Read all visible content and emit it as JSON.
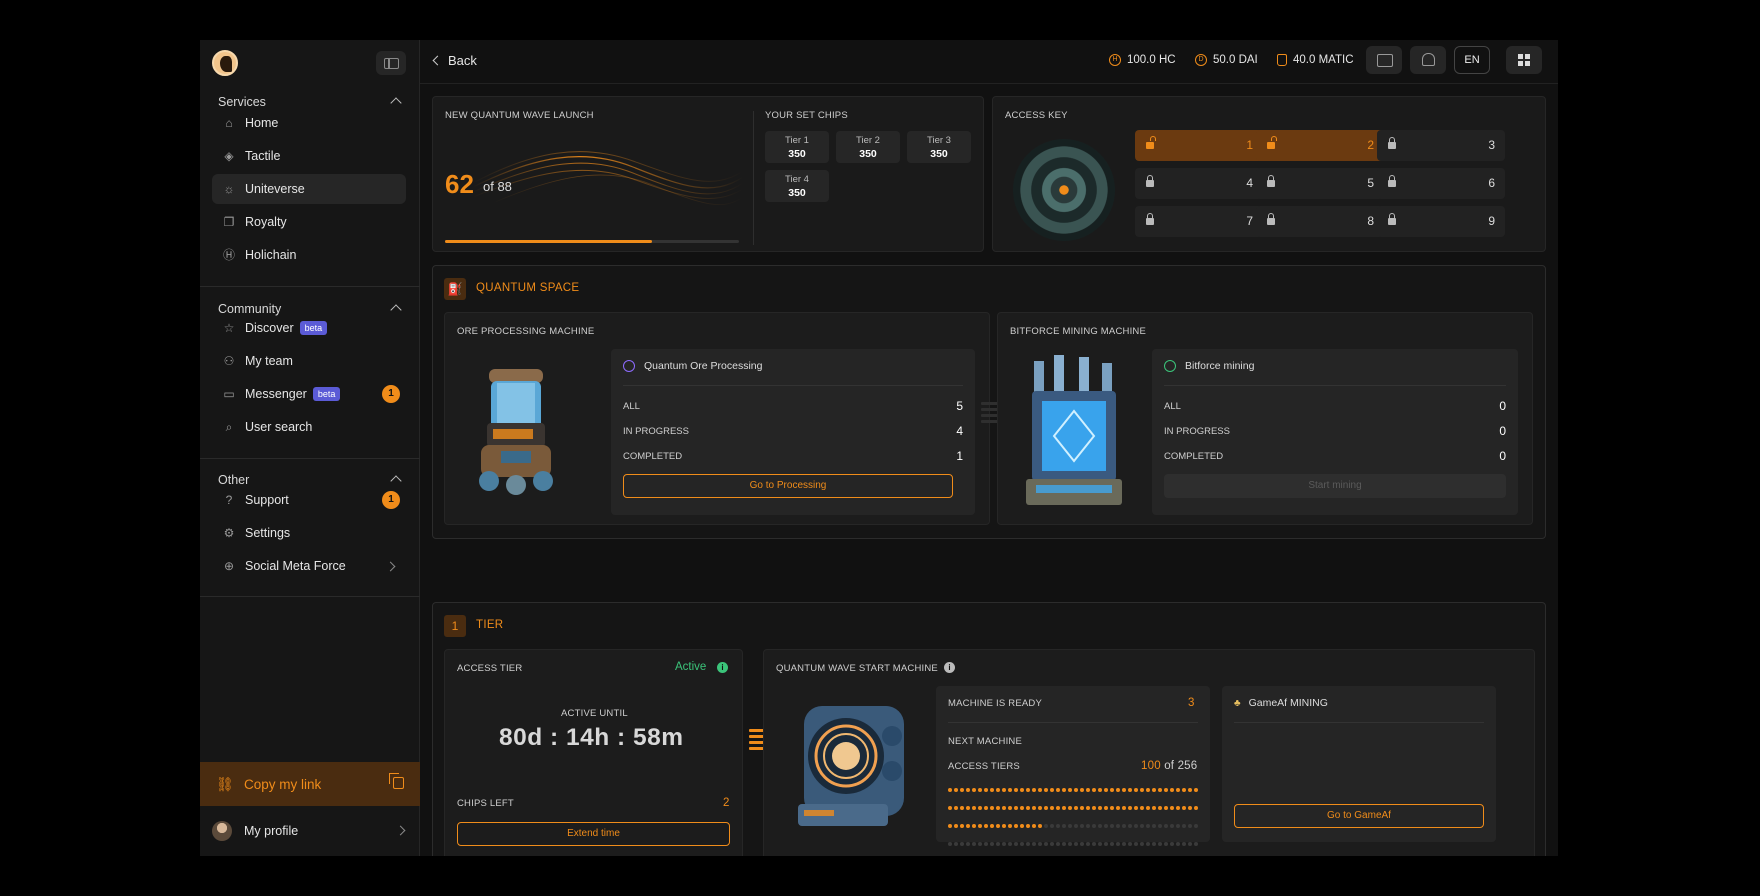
{
  "sidebar": {
    "services": {
      "title": "Services",
      "items": [
        {
          "label": "Home",
          "icon": "home-icon"
        },
        {
          "label": "Tactile",
          "icon": "layers-icon"
        },
        {
          "label": "Uniteverse",
          "icon": "sun-icon"
        },
        {
          "label": "Royalty",
          "icon": "copy-icon"
        },
        {
          "label": "Holichain",
          "icon": "holichain-icon"
        }
      ]
    },
    "community": {
      "title": "Community",
      "items": [
        {
          "label": "Discover",
          "badge": "beta"
        },
        {
          "label": "My team"
        },
        {
          "label": "Messenger",
          "badge": "beta",
          "count": "1"
        },
        {
          "label": "User search"
        }
      ]
    },
    "other": {
      "title": "Other",
      "items": [
        {
          "label": "Support",
          "count": "1"
        },
        {
          "label": "Settings"
        },
        {
          "label": "Social Meta Force"
        }
      ]
    },
    "copy_link": "Copy my link",
    "profile": "My profile"
  },
  "topbar": {
    "back": "Back",
    "balances": [
      {
        "value": "100.0 HC",
        "icon": "hc-coin-icon"
      },
      {
        "value": "50.0 DAI",
        "icon": "dai-coin-icon"
      },
      {
        "value": "40.0 MATIC",
        "icon": "wallet-icon"
      }
    ],
    "lang": "EN"
  },
  "wave": {
    "title": "NEW QUANTUM WAVE LAUNCH",
    "count": "62",
    "of": "of 88",
    "progress": 0.705
  },
  "chips": {
    "title": "YOUR SET CHIPS",
    "items": [
      {
        "tier": "Tier 1",
        "value": "350"
      },
      {
        "tier": "Tier 2",
        "value": "350"
      },
      {
        "tier": "Tier 3",
        "value": "350"
      },
      {
        "tier": "Tier 4",
        "value": "350"
      }
    ]
  },
  "access_key": {
    "title": "ACCESS KEY",
    "cells": [
      {
        "n": "1",
        "open": true
      },
      {
        "n": "2",
        "open": true
      },
      {
        "n": "3",
        "open": false
      },
      {
        "n": "4",
        "open": false
      },
      {
        "n": "5",
        "open": false
      },
      {
        "n": "6",
        "open": false
      },
      {
        "n": "7",
        "open": false
      },
      {
        "n": "8",
        "open": false
      },
      {
        "n": "9",
        "open": false
      }
    ]
  },
  "quantum_space": {
    "title": "QUANTUM SPACE",
    "ore": {
      "title": "ORE PROCESSING MACHINE",
      "card_title": "Quantum Ore Processing",
      "rows": [
        {
          "label": "ALL",
          "value": "5"
        },
        {
          "label": "IN PROGRESS",
          "value": "4"
        },
        {
          "label": "COMPLETED",
          "value": "1"
        }
      ],
      "button": "Go to Processing"
    },
    "mining": {
      "title": "BITFORCE MINING MACHINE",
      "card_title": "Bitforce mining",
      "rows": [
        {
          "label": "ALL",
          "value": "0"
        },
        {
          "label": "IN PROGRESS",
          "value": "0"
        },
        {
          "label": "COMPLETED",
          "value": "0"
        }
      ],
      "button": "Start mining"
    }
  },
  "tier": {
    "number": "1",
    "title": "TIER",
    "access": {
      "title": "ACCESS TIER",
      "status": "Active",
      "active_until_label": "ACTIVE UNTIL",
      "timer": "80d : 14h : 58m",
      "chips_left_label": "CHIPS LEFT",
      "chips_left": "2",
      "button": "Extend time"
    },
    "machine": {
      "title": "QUANTUM WAVE START MACHINE",
      "ready_label": "MACHINE IS READY",
      "ready_value": "3",
      "next_label": "NEXT MACHINE",
      "access_tiers_label": "ACCESS TIERS",
      "access_tiers_value": "100",
      "access_tiers_total": "of 256",
      "tiers_filled": 100,
      "tiers_total": 256
    },
    "gameaf": {
      "title": "GameAf MINING",
      "button": "Go to GameAf"
    }
  },
  "colors": {
    "accent": "#f08c1a",
    "success": "#3bc47a",
    "beta": "#5b5bd6"
  }
}
